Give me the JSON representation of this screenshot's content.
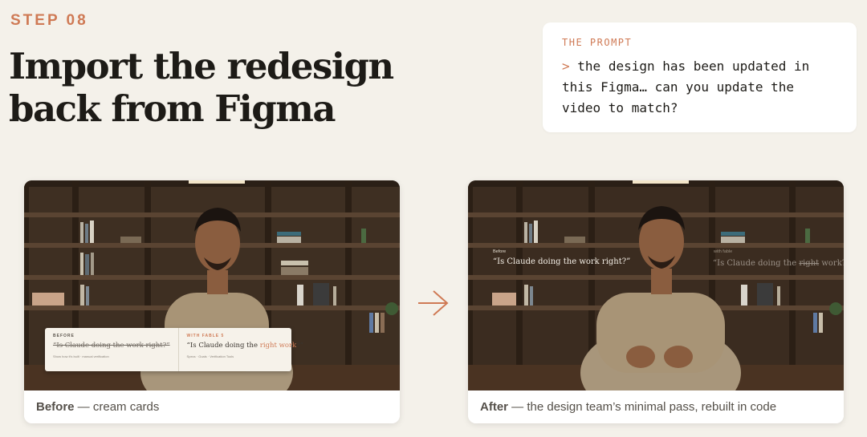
{
  "step": "STEP 08",
  "title": {
    "line1": "Import the redesign",
    "line2": "back from Figma"
  },
  "prompt": {
    "label": "THE PROMPT",
    "caret": ">",
    "line1": "the design has been updated in",
    "line2": "this Figma… can you update the",
    "line3": "video to match?"
  },
  "before": {
    "caption_bold": "Before",
    "caption_rest": " — cream cards",
    "overlay": {
      "left_tag": "BEFORE",
      "left_quote": "“Is Claude doing the work right?”",
      "left_sub": "Show how it's built · manual verification",
      "right_tag": "WITH FABLE 5",
      "right_quote_a": "“Is Claude doing the ",
      "right_quote_hl": "right work",
      "right_quote_b": "?”",
      "right_sub": "Specs · Goals · Verification Tools"
    }
  },
  "after": {
    "caption_bold": "After",
    "caption_rest": " — the design team’s minimal pass, rebuilt in code",
    "overlay": {
      "left_label": "Before",
      "left_quote": "“Is Claude doing the work right?”",
      "right_label": "with fable",
      "right_quote_a": "“Is Claude doing the ",
      "right_quote_strike": "right",
      "right_quote_b": " work?”"
    }
  },
  "colors": {
    "accent": "#cf7a55",
    "background": "#f4f1ea",
    "card": "#ffffff"
  },
  "icons": {
    "arrow": "arrow-right-icon"
  }
}
